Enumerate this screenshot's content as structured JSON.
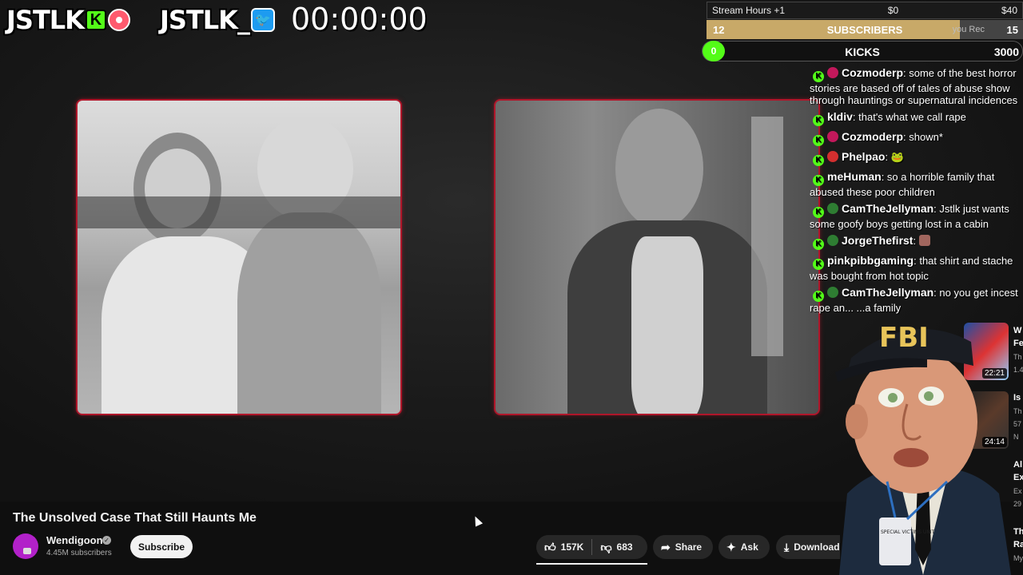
{
  "overlay": {
    "kick_brand": "JSTLK",
    "kick_badge": "K",
    "twitter_brand": "JSTLK_",
    "timer": "00:00:00"
  },
  "goals": {
    "stream_hours_label": "Stream Hours +1",
    "stream_min": "$0",
    "stream_max": "$40",
    "subs_current": "12",
    "subs_label": "SUBSCRIBERS",
    "subs_target": "15",
    "subs_ghost": "you   Rec",
    "subs_progress": 0.8,
    "kicks_current": "0",
    "kicks_label": "KICKS",
    "kicks_target": "3000"
  },
  "chat": [
    {
      "user": "Cozmoderp",
      "badge_color": "#c2185b",
      "text": "some of the best horror stories are based off of tales of abuse show through hauntings or supernatural incidences"
    },
    {
      "user": "kldiv",
      "badge_color": "",
      "text": "that's what we call rape"
    },
    {
      "user": "Cozmoderp",
      "badge_color": "#c2185b",
      "text": "shown*"
    },
    {
      "user": "Phelpao",
      "badge_color": "#d32f2f",
      "text": "🐸"
    },
    {
      "user": "meHuman",
      "badge_color": "",
      "text": "so a horrible family that abused these poor children"
    },
    {
      "user": "CamTheJellyman",
      "badge_color": "#2e7d32",
      "text": "Jstlk just wants some goofy boys getting lost in a cabin"
    },
    {
      "user": "JorgeThefirst",
      "badge_color": "#2e7d32",
      "text": ""
    },
    {
      "user": "pinkpibbgaming",
      "badge_color": "",
      "text": "that shirt and stache was bought from hot topic"
    },
    {
      "user": "CamTheJellyman",
      "badge_color": "#2e7d32",
      "text": "no you get incest rape an... ...a family"
    }
  ],
  "suggestions": [
    {
      "duration": "22:21",
      "title_frag": "W",
      "sub1": "Fe",
      "sub2": "Th",
      "sub3": "1.4"
    },
    {
      "duration": "24:14",
      "title_frag": "Is",
      "sub1": "Th",
      "sub2": "57",
      "sub3": "N"
    },
    {
      "title_frag": "Al",
      "sub1": "Ex",
      "sub2": "Ex",
      "sub3": "29"
    },
    {
      "title_frag": "Th",
      "sub1": "Ra",
      "sub2": "My"
    }
  ],
  "mascot": {
    "cap_text": "FBI",
    "badge_text": "SPECIAL VICTIMS UNIT"
  },
  "video": {
    "title": "The Unsolved Case That Still Haunts Me",
    "channel": "Wendigoon",
    "subscribers": "4.45M subscribers",
    "subscribe_label": "Subscribe",
    "likes": "157K",
    "dislikes": "683",
    "share_label": "Share",
    "ask_label": "Ask",
    "download_label": "Download"
  },
  "colors": {
    "accent_red": "#b0162a",
    "kick_green": "#53fc18",
    "gold": "#c8a968"
  }
}
